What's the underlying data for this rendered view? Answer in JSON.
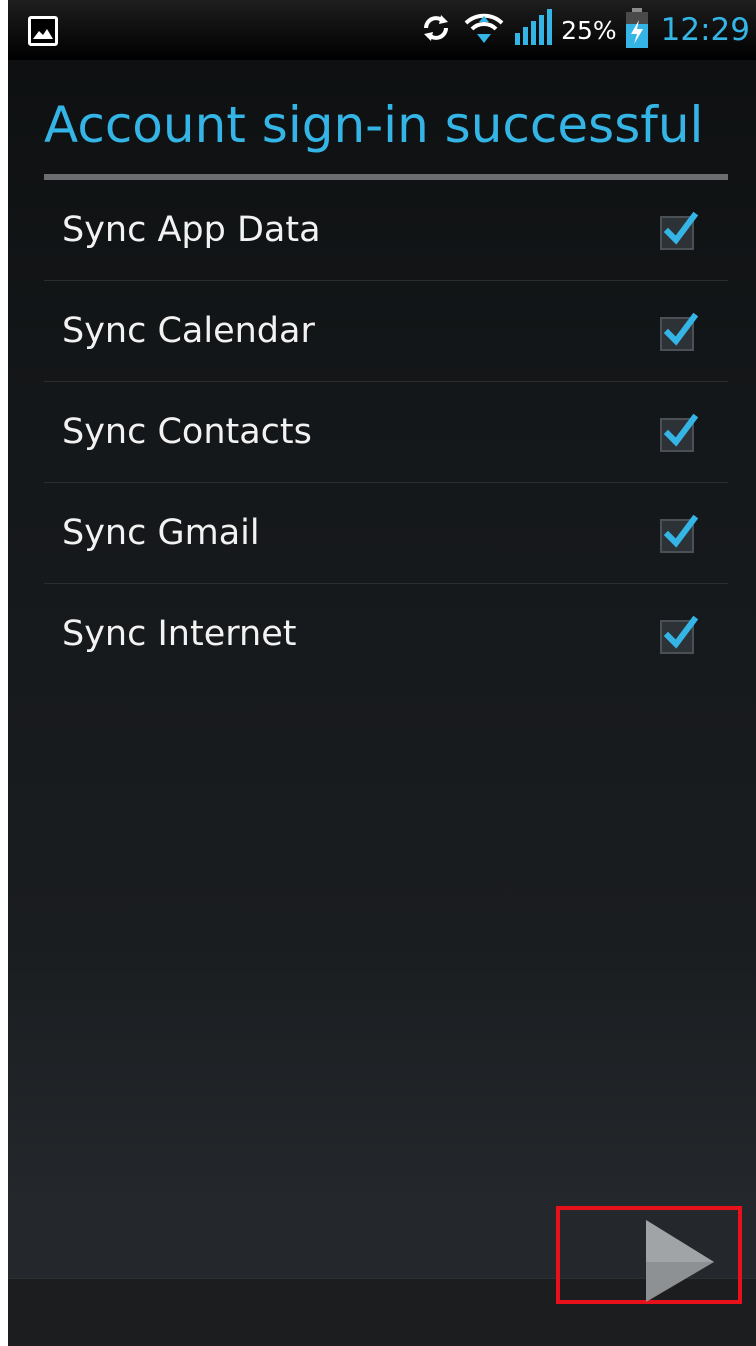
{
  "status_bar": {
    "battery_percent": "25%",
    "time": "12:29",
    "icons": [
      "gallery-icon",
      "sync-icon",
      "wifi-icon",
      "signal-icon",
      "battery-charging-icon"
    ],
    "accent_color": "#35b4e6"
  },
  "page": {
    "title": "Account sign-in successful"
  },
  "sync_options": [
    {
      "label": "Sync App Data",
      "checked": true
    },
    {
      "label": "Sync Calendar",
      "checked": true
    },
    {
      "label": "Sync Contacts",
      "checked": true
    },
    {
      "label": "Sync Gmail",
      "checked": true
    },
    {
      "label": "Sync Internet",
      "checked": true
    }
  ],
  "navigation": {
    "next_icon": "next-arrow-icon",
    "highlight_color": "#e8101a"
  }
}
